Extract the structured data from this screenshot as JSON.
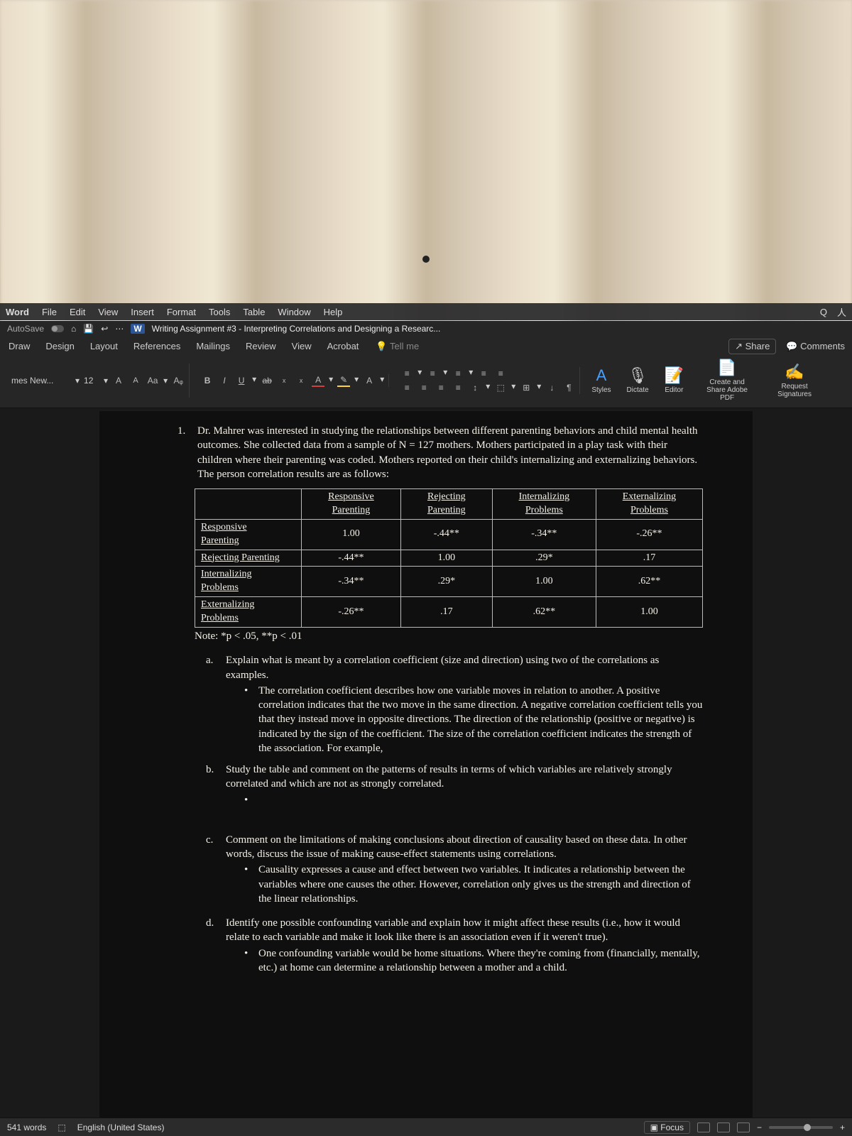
{
  "mac_menu": {
    "app": "Word",
    "items": [
      "File",
      "Edit",
      "View",
      "Insert",
      "Format",
      "Tools",
      "Table",
      "Window",
      "Help"
    ],
    "right": [
      "Q",
      "人"
    ]
  },
  "title_row": {
    "autosave_label": "AutoSave",
    "home_glyph": "⌂",
    "save_glyph": "💾",
    "undo_glyph": "↩︎",
    "more_glyph": "⋯",
    "word_icon": "W",
    "doc_title": "Writing Assignment #3 - Interpreting Correlations and Designing a Researc..."
  },
  "ribbon_tabs": {
    "items": [
      "Draw",
      "Design",
      "Layout",
      "References",
      "Mailings",
      "Review",
      "View",
      "Acrobat"
    ],
    "tellme": "Tell me",
    "share": "Share",
    "comments": "Comments"
  },
  "ribbon": {
    "font_name": "mes New...",
    "font_size": "12",
    "A_up": "A",
    "A_dn": "A",
    "Aa": "Aa",
    "clear": "Aᵩ",
    "B": "B",
    "I": "I",
    "U": "U",
    "strike": "ab",
    "sub": "x",
    "sup": "x",
    "font_color": "A",
    "highlight": "✎",
    "a_border": "A",
    "bullets": "≡",
    "numbers": "≡",
    "multilevel": "≡",
    "indent_dec": "≡",
    "indent_inc": "≡",
    "align_l": "≡",
    "align_c": "≡",
    "align_r": "≡",
    "align_j": "≡",
    "line_sp": "↕",
    "shading": "⬚",
    "borders": "⊞",
    "sort": "↓",
    "para": "¶",
    "styles_A": "A",
    "styles": "Styles",
    "dictate_ico": "🎙",
    "dictate": "Dictate",
    "editor_ico": "📝",
    "editor": "Editor",
    "adobe1": "Create and Share Adobe PDF",
    "adobe2": "Request Signatures"
  },
  "doc": {
    "q1_intro": "Dr. Mahrer was interested in studying the relationships between different parenting behaviors and child mental health outcomes. She collected data from a sample of N = 127 mothers. Mothers participated in a play task with their children where their parenting was coded. Mothers reported on their child's internalizing and externalizing behaviors. The person correlation results are as follows:",
    "table": {
      "headers": [
        "",
        "Responsive Parenting",
        "Rejecting Parenting",
        "Internalizing Problems",
        "Externalizing Problems"
      ],
      "rows": [
        [
          "Responsive Parenting",
          "1.00",
          "-.44**",
          "-.34**",
          "-.26**"
        ],
        [
          "Rejecting Parenting",
          "-.44**",
          "1.00",
          ".29*",
          ".17"
        ],
        [
          "Internalizing Problems",
          "-.34**",
          ".29*",
          "1.00",
          ".62**"
        ],
        [
          "Externalizing Problems",
          "-.26**",
          ".17",
          ".62**",
          "1.00"
        ]
      ],
      "note": "Note: *p < .05, **p < .01"
    },
    "a_q": "Explain what is meant by a correlation coefficient (size and direction) using two of the correlations as examples.",
    "a_ans": "The correlation coefficient describes how one variable moves in relation to another. A positive correlation indicates that the two move in the same direction. A negative correlation coefficient tells you that they instead move in opposite directions. The direction of the relationship (positive or negative) is indicated by the sign of the coefficient. The size of the correlation coefficient indicates the strength of the association. For example,",
    "b_q": "Study the table and comment on the patterns of results in terms of which variables are relatively strongly correlated and which are not as strongly correlated.",
    "c_q": "Comment on the limitations of making conclusions about direction of causality based on these data. In other words, discuss the issue of making cause-effect statements using correlations.",
    "c_ans": "Causality expresses a cause and effect between two variables. It indicates a relationship between the variables where one causes the other. However, correlation only gives us the strength and direction of the linear relationships.",
    "d_q": "Identify one possible confounding variable and explain how it might affect these results (i.e., how it would relate to each variable and make it look like there is an association even if it weren't true).",
    "d_ans": "One confounding variable would be home situations. Where they're coming from (financially, mentally, etc.) at home can determine a relationship between a mother and a child."
  },
  "status": {
    "words": "541 words",
    "proof": "⬚",
    "lang": "English (United States)",
    "focus": "Focus",
    "minus": "−",
    "plus": "+"
  }
}
